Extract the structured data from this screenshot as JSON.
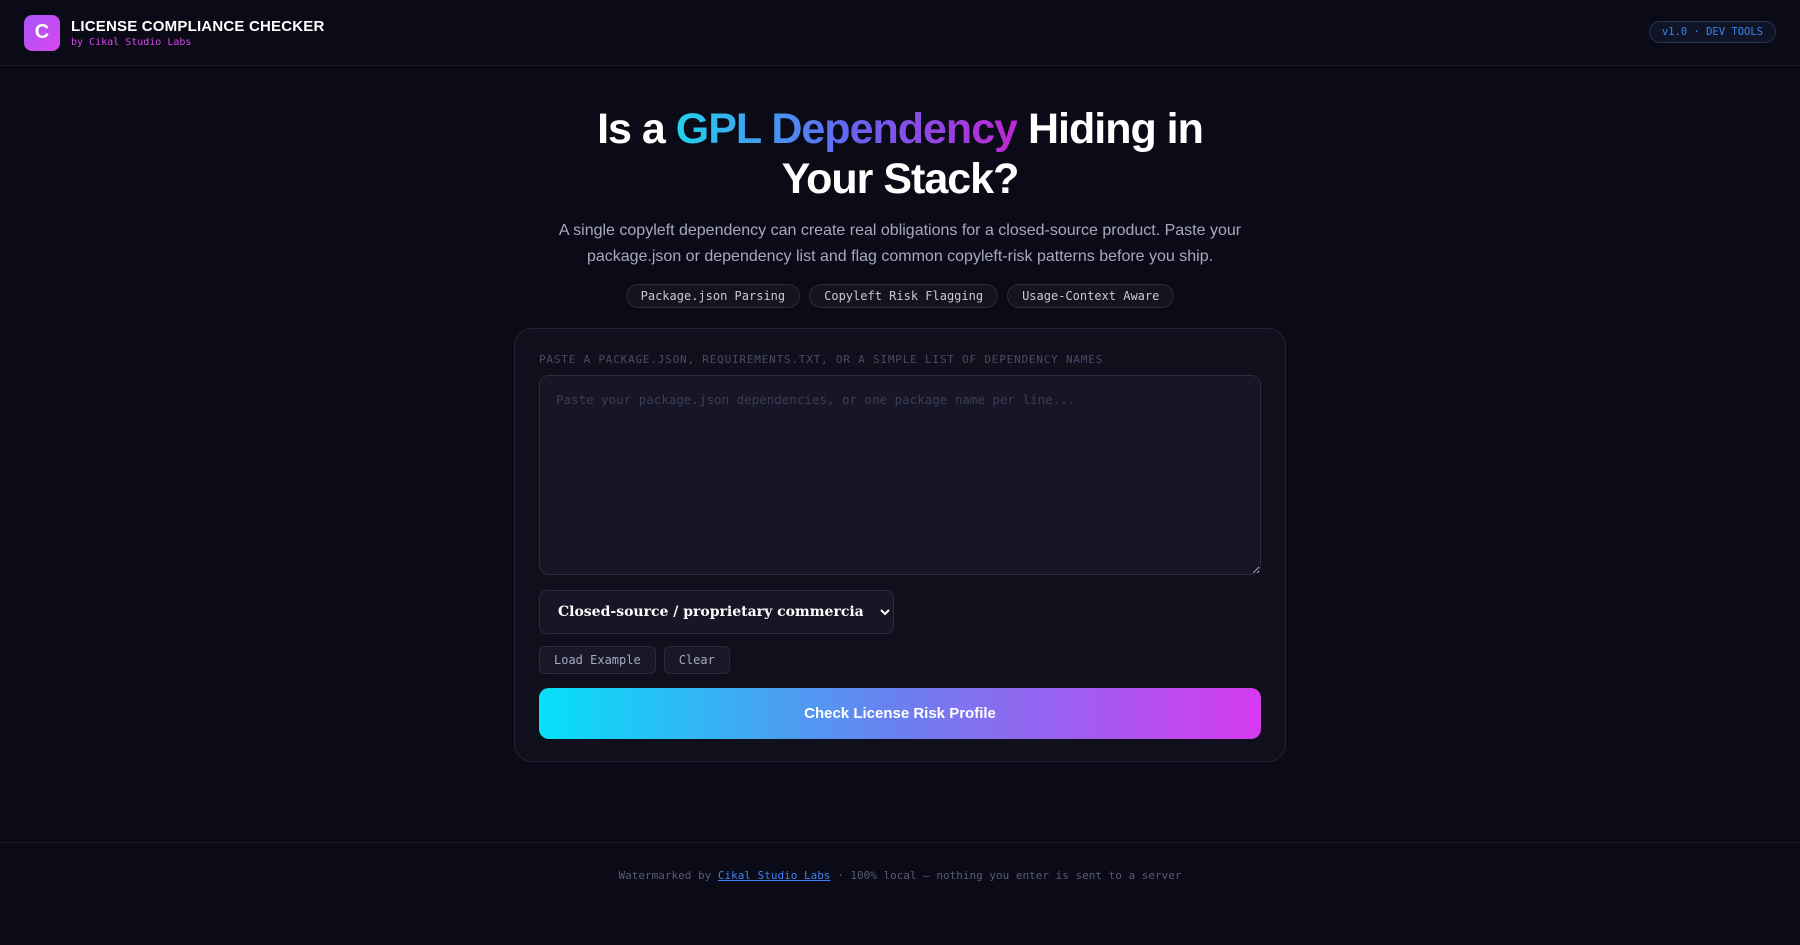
{
  "header": {
    "logo_letter": "C",
    "title": "LICENSE COMPLIANCE CHECKER",
    "subtitle": "by Cikal Studio Labs",
    "version": "v1.0 · DEV TOOLS"
  },
  "hero": {
    "title_pre": "Is a ",
    "title_highlight": "GPL Dependency",
    "title_post": " Hiding in Your Stack?",
    "description": "A single copyleft dependency can create real obligations for a closed-source product. Paste your package.json or dependency list and flag common copyleft-risk patterns before you ship.",
    "pills": [
      "Package.json Parsing",
      "Copyleft Risk Flagging",
      "Usage-Context Aware"
    ]
  },
  "form": {
    "label": "PASTE A PACKAGE.JSON, REQUIREMENTS.TXT, OR A SIMPLE LIST OF DEPENDENCY NAMES",
    "textarea_placeholder": "Paste your package.json dependencies, or one package name per line...",
    "usage_selected": "Closed-source / proprietary commercial",
    "load_example": "Load Example",
    "clear": "Clear",
    "submit": "Check License Risk Profile"
  },
  "footer": {
    "prefix": "Watermarked by ",
    "link": "Cikal Studio Labs",
    "suffix": " · 100% local — nothing you enter is sent to a server"
  }
}
